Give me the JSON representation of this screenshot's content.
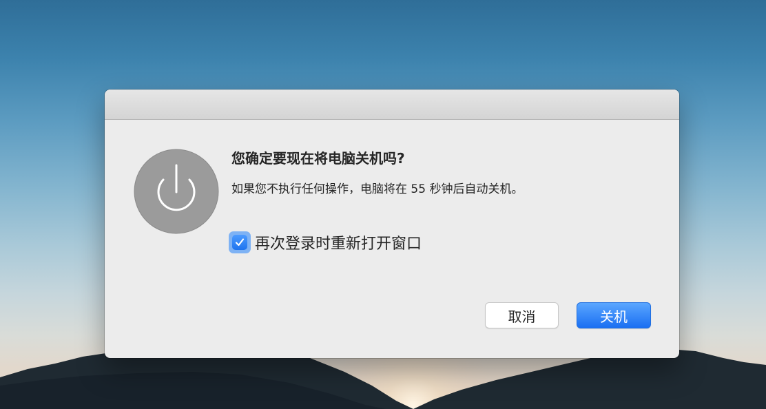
{
  "dialog": {
    "icon": "power-icon",
    "title": "您确定要现在将电脑关机吗?",
    "message": "如果您不执行任何操作，电脑将在 55 秒钟后自动关机。",
    "reopen_checkbox": {
      "label": "再次登录时重新打开窗口",
      "checked": true
    },
    "buttons": {
      "cancel_label": "取消",
      "shutdown_label": "关机"
    }
  },
  "colors": {
    "accent": "#1f74ee",
    "dialog_bg": "#ececec",
    "icon_bg": "#9b9b9b"
  }
}
